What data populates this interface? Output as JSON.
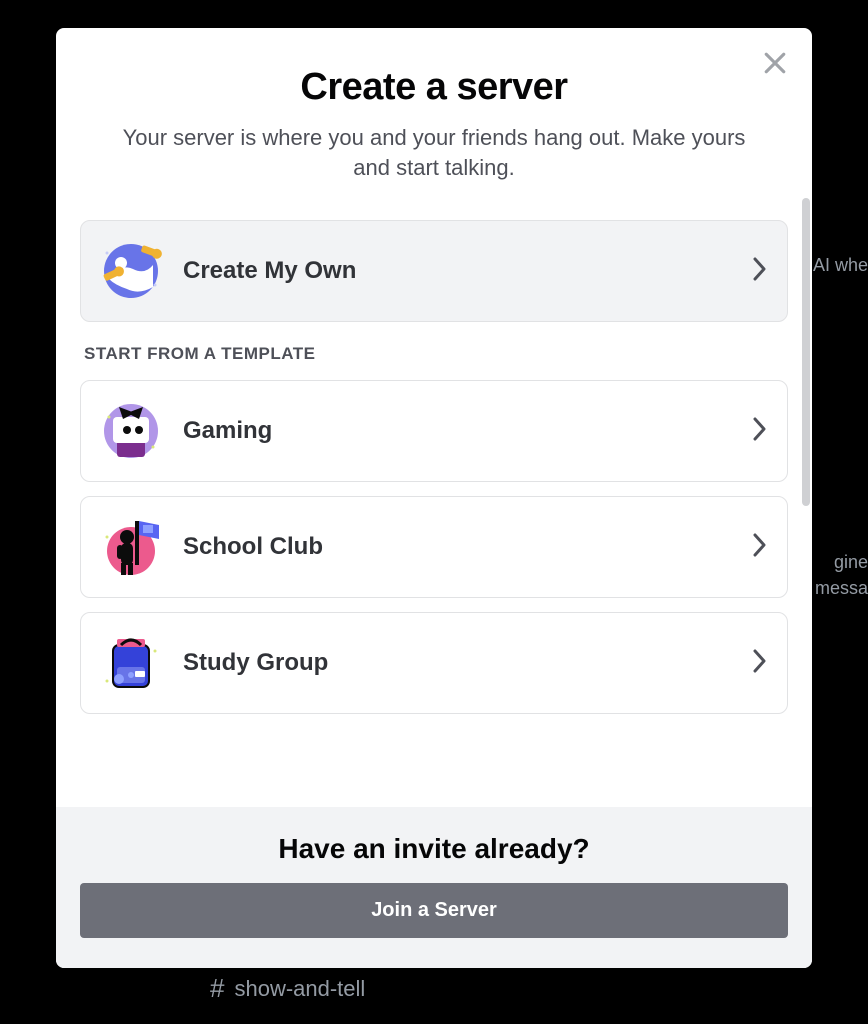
{
  "backdrop": {
    "text1": "AI whe",
    "text2": "gine",
    "text3": "t messa",
    "channel": "show-and-tell"
  },
  "modal": {
    "title": "Create a server",
    "subtitle": "Your server is where you and your friends hang out. Make yours and start talking.",
    "primary_option": {
      "label": "Create My Own"
    },
    "template_section_label": "START FROM A TEMPLATE",
    "templates": [
      {
        "label": "Gaming"
      },
      {
        "label": "School Club"
      },
      {
        "label": "Study Group"
      }
    ],
    "footer": {
      "title": "Have an invite already?",
      "button": "Join a Server"
    }
  }
}
